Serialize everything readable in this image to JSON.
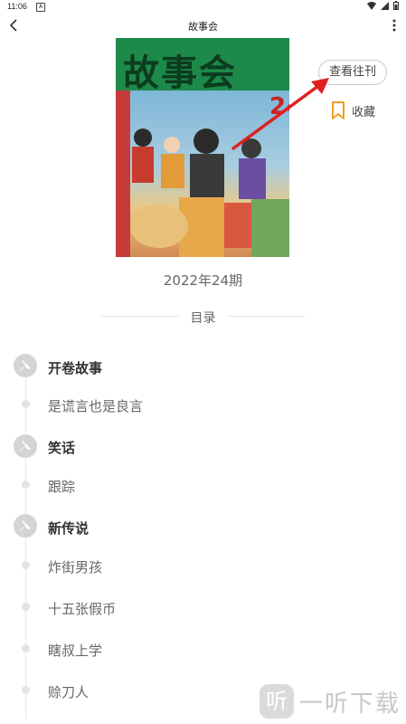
{
  "status_bar": {
    "time": "11:06"
  },
  "app_bar": {
    "title": "故事会"
  },
  "cover": {
    "title_text": "故事会",
    "issue_badge": "24",
    "icon": "magazine-cover-image"
  },
  "issue": {
    "label": "2022年24期"
  },
  "actions": {
    "past_issues_label": "查看往刊",
    "favorite_label": "收藏",
    "favorite_icon": "bookmark-icon",
    "accent_color": "#f0a020"
  },
  "annotation": {
    "arrow_color": "#e02020"
  },
  "toc": {
    "label": "目录",
    "sections": [
      {
        "title": "开卷故事",
        "items": [
          "是谎言也是良言"
        ]
      },
      {
        "title": "笑话",
        "items": [
          "跟踪"
        ]
      },
      {
        "title": "新传说",
        "items": [
          "炸街男孩",
          "十五张假币",
          "瞎叔上学",
          "赊刀人"
        ]
      }
    ]
  },
  "watermark": {
    "logo_char": "听",
    "text": "一听下载"
  }
}
